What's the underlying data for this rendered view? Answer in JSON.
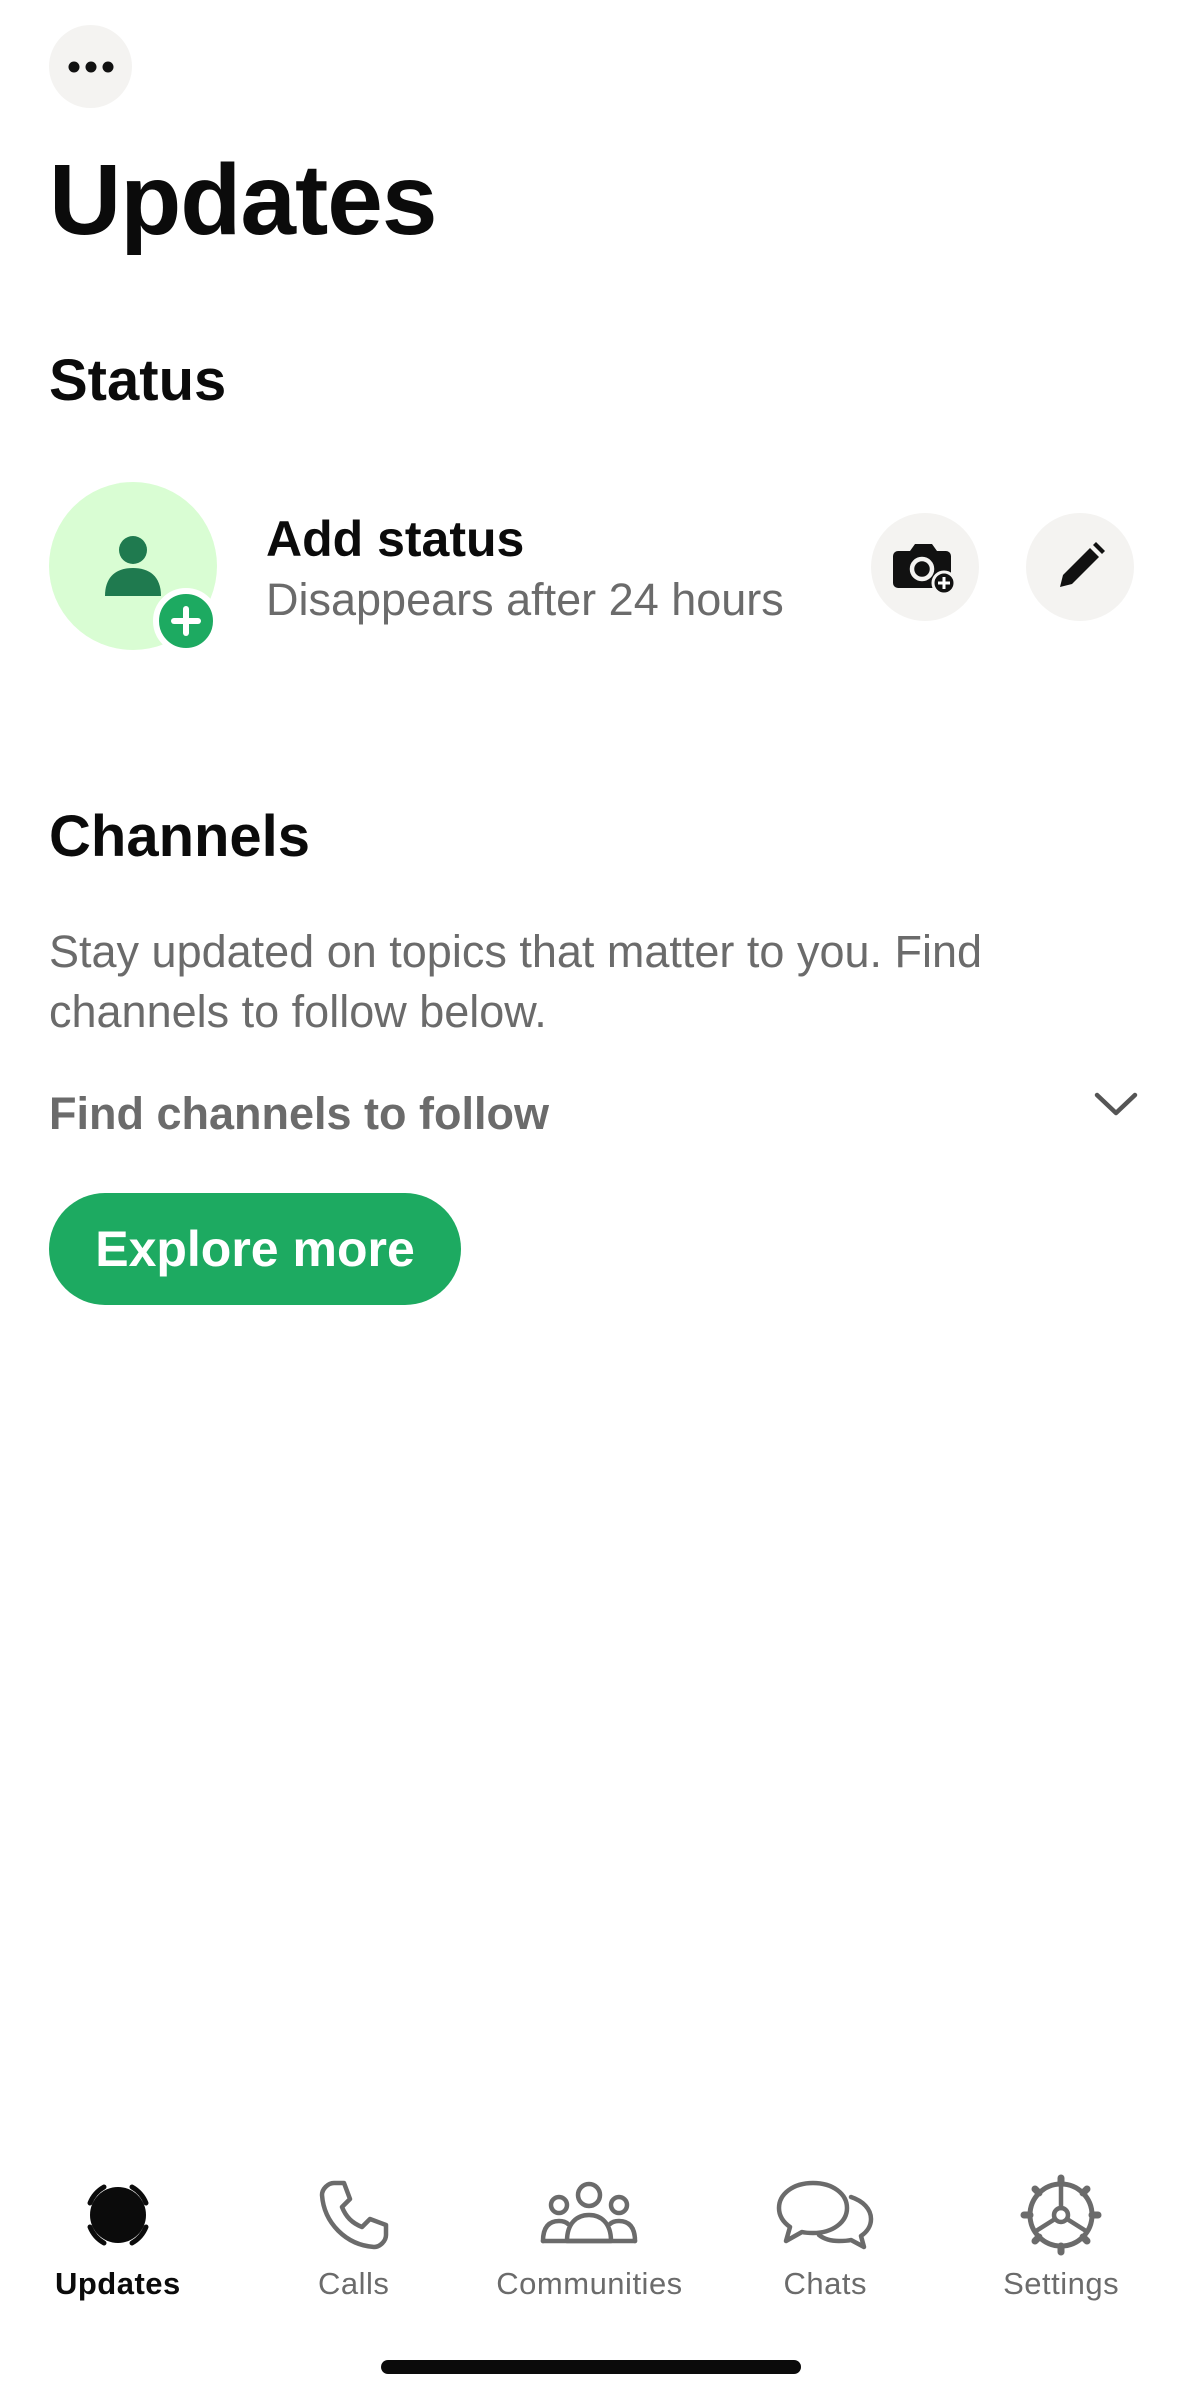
{
  "header": {
    "more_icon": "ellipsis-icon",
    "title": "Updates"
  },
  "status": {
    "section_title": "Status",
    "add_status_title": "Add status",
    "add_status_subtitle": "Disappears after 24 hours",
    "avatar_icon": "person-icon",
    "badge_icon": "plus-icon",
    "camera_icon": "camera-plus-icon",
    "pencil_icon": "pencil-icon"
  },
  "channels": {
    "section_title": "Channels",
    "description": "Stay updated on topics that matter to you. Find channels to follow below.",
    "find_label": "Find channels to follow",
    "expand_icon": "chevron-down-icon",
    "explore_button": "Explore more"
  },
  "tabbar": {
    "items": [
      {
        "label": "Updates",
        "icon": "updates-icon",
        "active": true
      },
      {
        "label": "Calls",
        "icon": "phone-icon",
        "active": false
      },
      {
        "label": "Communities",
        "icon": "communities-icon",
        "active": false
      },
      {
        "label": "Chats",
        "icon": "chats-icon",
        "active": false
      },
      {
        "label": "Settings",
        "icon": "gear-icon",
        "active": false
      }
    ]
  },
  "colors": {
    "accent_green": "#1daa61",
    "avatar_bg": "#d9fdd3",
    "button_bg": "#f4f3f1",
    "secondary_text": "#6b6b6b"
  }
}
